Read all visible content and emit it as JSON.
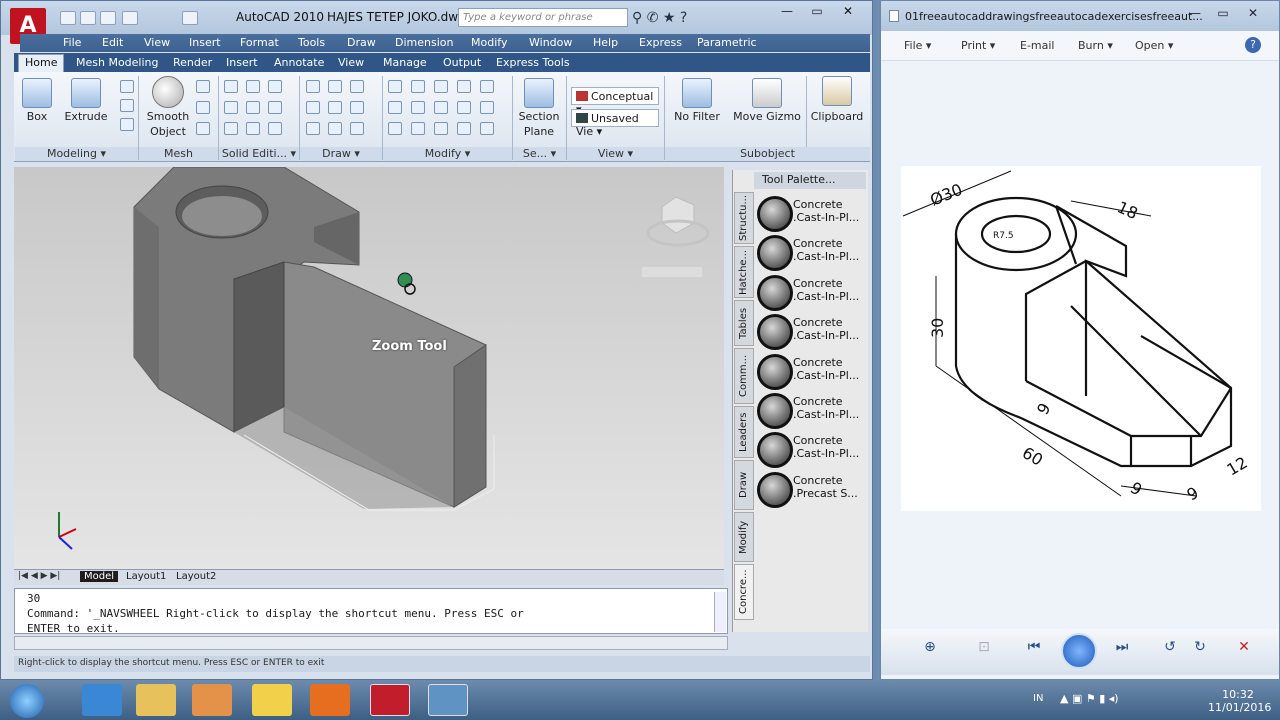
{
  "acad": {
    "app_title": "AutoCAD 2010",
    "file_title": "HAJES TETEP JOKO.dwg",
    "search_placeholder": "Type a keyword or phrase",
    "logo": "A",
    "menu": [
      "File",
      "Edit",
      "View",
      "Insert",
      "Format",
      "Tools",
      "Draw",
      "Dimension",
      "Modify",
      "Window",
      "Help",
      "Express",
      "Parametric"
    ],
    "ribbon_tabs": [
      "Home",
      "Mesh Modeling",
      "Render",
      "Insert",
      "Annotate",
      "View",
      "Manage",
      "Output",
      "Express Tools"
    ],
    "ribbon": {
      "box": "Box",
      "extrude": "Extrude",
      "smooth_object_1": "Smooth",
      "smooth_object_2": "Object",
      "section_plane_1": "Section",
      "section_plane_2": "Plane",
      "visual_style": "Conceptual",
      "view_state": "Unsaved Vie",
      "no_filter": "No Filter",
      "move_gizmo": "Move Gizmo",
      "clipboard": "Clipboard"
    },
    "panels": [
      "Modeling",
      "Mesh",
      "Solid Editi...",
      "Draw",
      "Modify",
      "Se...",
      "View",
      "Subobject"
    ],
    "viewport": {
      "zoom_tooltip": "Zoom Tool"
    },
    "layout_tabs": [
      "Model",
      "Layout1",
      "Layout2"
    ],
    "command_lines": [
      "30",
      "Command: '_NAVSWHEEL Right-click to display the shortcut menu. Press ESC or",
      "ENTER to exit."
    ],
    "status": "Right-click to display the shortcut menu. Press ESC or ENTER to exit",
    "palette": {
      "title": "Tool Palette...",
      "tabs": [
        "Structu...",
        "Hatche...",
        "Tables",
        "Comm...",
        "Leaders",
        "Draw",
        "Modify",
        "Concre..."
      ],
      "items": [
        {
          "l1": "Concrete",
          "l2": ".Cast-In-Pl..."
        },
        {
          "l1": "Concrete",
          "l2": ".Cast-In-Pl..."
        },
        {
          "l1": "Concrete",
          "l2": ".Cast-In-Pl..."
        },
        {
          "l1": "Concrete",
          "l2": ".Cast-In-Pl..."
        },
        {
          "l1": "Concrete",
          "l2": ".Cast-In-Pl..."
        },
        {
          "l1": "Concrete",
          "l2": ".Cast-In-Pl..."
        },
        {
          "l1": "Concrete",
          "l2": ".Cast-In-Pl..."
        },
        {
          "l1": "Concrete",
          "l2": ".Precast S..."
        }
      ]
    }
  },
  "pdf": {
    "title": "01freeautocaddrawingsfreeautocadexercisesfreeaut...",
    "menu": [
      "File",
      "Print",
      "E-mail",
      "Burn",
      "Open"
    ],
    "dims": {
      "d30": "Ø30",
      "d18": "18",
      "r75": "R7.5",
      "h30": "30",
      "d9a": "9",
      "d60": "60",
      "d9b": "9",
      "d9c": "9",
      "d12": "12"
    }
  },
  "taskbar": {
    "lang": "IN",
    "time": "10:32",
    "date": "11/01/2016"
  }
}
